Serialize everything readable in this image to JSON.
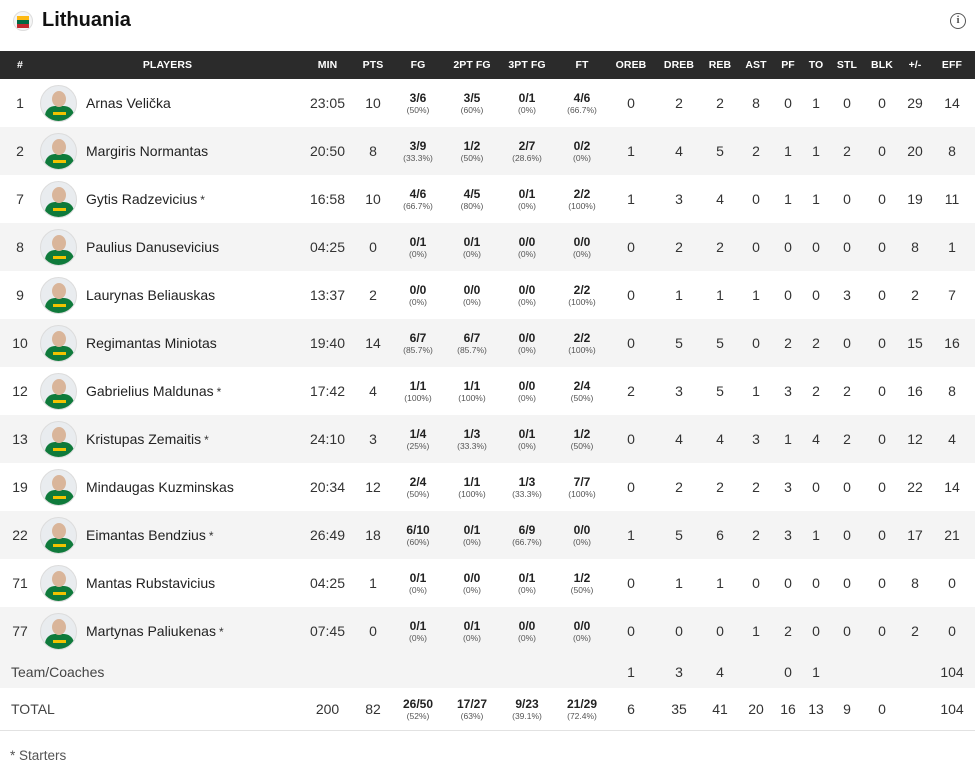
{
  "team": {
    "name": "Lithuania"
  },
  "headers": {
    "num": "#",
    "players": "PLAYERS",
    "min": "MIN",
    "pts": "PTS",
    "fg": "FG",
    "fg2": "2PT FG",
    "fg3": "3PT FG",
    "ft": "FT",
    "oreb": "OREB",
    "dreb": "DREB",
    "reb": "REB",
    "ast": "AST",
    "pf": "PF",
    "to": "TO",
    "stl": "STL",
    "blk": "BLK",
    "pm": "+/-",
    "eff": "EFF"
  },
  "players": [
    {
      "num": "1",
      "name": "Arnas Velička",
      "starter": "",
      "min": "23:05",
      "pts": "10",
      "fg": "3/6",
      "fg_pct": "(50%)",
      "fg2": "3/5",
      "fg2_pct": "(60%)",
      "fg3": "0/1",
      "fg3_pct": "(0%)",
      "ft": "4/6",
      "ft_pct": "(66.7%)",
      "oreb": "0",
      "dreb": "2",
      "reb": "2",
      "ast": "8",
      "pf": "0",
      "to": "1",
      "stl": "0",
      "blk": "0",
      "pm": "29",
      "eff": "14"
    },
    {
      "num": "2",
      "name": "Margiris Normantas",
      "starter": "",
      "min": "20:50",
      "pts": "8",
      "fg": "3/9",
      "fg_pct": "(33.3%)",
      "fg2": "1/2",
      "fg2_pct": "(50%)",
      "fg3": "2/7",
      "fg3_pct": "(28.6%)",
      "ft": "0/2",
      "ft_pct": "(0%)",
      "oreb": "1",
      "dreb": "4",
      "reb": "5",
      "ast": "2",
      "pf": "1",
      "to": "1",
      "stl": "2",
      "blk": "0",
      "pm": "20",
      "eff": "8"
    },
    {
      "num": "7",
      "name": "Gytis Radzevicius",
      "starter": "*",
      "min": "16:58",
      "pts": "10",
      "fg": "4/6",
      "fg_pct": "(66.7%)",
      "fg2": "4/5",
      "fg2_pct": "(80%)",
      "fg3": "0/1",
      "fg3_pct": "(0%)",
      "ft": "2/2",
      "ft_pct": "(100%)",
      "oreb": "1",
      "dreb": "3",
      "reb": "4",
      "ast": "0",
      "pf": "1",
      "to": "1",
      "stl": "0",
      "blk": "0",
      "pm": "19",
      "eff": "11"
    },
    {
      "num": "8",
      "name": "Paulius Danusevicius",
      "starter": "",
      "min": "04:25",
      "pts": "0",
      "fg": "0/1",
      "fg_pct": "(0%)",
      "fg2": "0/1",
      "fg2_pct": "(0%)",
      "fg3": "0/0",
      "fg3_pct": "(0%)",
      "ft": "0/0",
      "ft_pct": "(0%)",
      "oreb": "0",
      "dreb": "2",
      "reb": "2",
      "ast": "0",
      "pf": "0",
      "to": "0",
      "stl": "0",
      "blk": "0",
      "pm": "8",
      "eff": "1"
    },
    {
      "num": "9",
      "name": "Laurynas Beliauskas",
      "starter": "",
      "min": "13:37",
      "pts": "2",
      "fg": "0/0",
      "fg_pct": "(0%)",
      "fg2": "0/0",
      "fg2_pct": "(0%)",
      "fg3": "0/0",
      "fg3_pct": "(0%)",
      "ft": "2/2",
      "ft_pct": "(100%)",
      "oreb": "0",
      "dreb": "1",
      "reb": "1",
      "ast": "1",
      "pf": "0",
      "to": "0",
      "stl": "3",
      "blk": "0",
      "pm": "2",
      "eff": "7"
    },
    {
      "num": "10",
      "name": "Regimantas Miniotas",
      "starter": "",
      "min": "19:40",
      "pts": "14",
      "fg": "6/7",
      "fg_pct": "(85.7%)",
      "fg2": "6/7",
      "fg2_pct": "(85.7%)",
      "fg3": "0/0",
      "fg3_pct": "(0%)",
      "ft": "2/2",
      "ft_pct": "(100%)",
      "oreb": "0",
      "dreb": "5",
      "reb": "5",
      "ast": "0",
      "pf": "2",
      "to": "2",
      "stl": "0",
      "blk": "0",
      "pm": "15",
      "eff": "16"
    },
    {
      "num": "12",
      "name": "Gabrielius Maldunas",
      "starter": "*",
      "min": "17:42",
      "pts": "4",
      "fg": "1/1",
      "fg_pct": "(100%)",
      "fg2": "1/1",
      "fg2_pct": "(100%)",
      "fg3": "0/0",
      "fg3_pct": "(0%)",
      "ft": "2/4",
      "ft_pct": "(50%)",
      "oreb": "2",
      "dreb": "3",
      "reb": "5",
      "ast": "1",
      "pf": "3",
      "to": "2",
      "stl": "2",
      "blk": "0",
      "pm": "16",
      "eff": "8"
    },
    {
      "num": "13",
      "name": "Kristupas Zemaitis",
      "starter": "*",
      "min": "24:10",
      "pts": "3",
      "fg": "1/4",
      "fg_pct": "(25%)",
      "fg2": "1/3",
      "fg2_pct": "(33.3%)",
      "fg3": "0/1",
      "fg3_pct": "(0%)",
      "ft": "1/2",
      "ft_pct": "(50%)",
      "oreb": "0",
      "dreb": "4",
      "reb": "4",
      "ast": "3",
      "pf": "1",
      "to": "4",
      "stl": "2",
      "blk": "0",
      "pm": "12",
      "eff": "4"
    },
    {
      "num": "19",
      "name": "Mindaugas Kuzminskas",
      "starter": "",
      "min": "20:34",
      "pts": "12",
      "fg": "2/4",
      "fg_pct": "(50%)",
      "fg2": "1/1",
      "fg2_pct": "(100%)",
      "fg3": "1/3",
      "fg3_pct": "(33.3%)",
      "ft": "7/7",
      "ft_pct": "(100%)",
      "oreb": "0",
      "dreb": "2",
      "reb": "2",
      "ast": "2",
      "pf": "3",
      "to": "0",
      "stl": "0",
      "blk": "0",
      "pm": "22",
      "eff": "14"
    },
    {
      "num": "22",
      "name": "Eimantas Bendzius",
      "starter": "*",
      "min": "26:49",
      "pts": "18",
      "fg": "6/10",
      "fg_pct": "(60%)",
      "fg2": "0/1",
      "fg2_pct": "(0%)",
      "fg3": "6/9",
      "fg3_pct": "(66.7%)",
      "ft": "0/0",
      "ft_pct": "(0%)",
      "oreb": "1",
      "dreb": "5",
      "reb": "6",
      "ast": "2",
      "pf": "3",
      "to": "1",
      "stl": "0",
      "blk": "0",
      "pm": "17",
      "eff": "21"
    },
    {
      "num": "71",
      "name": "Mantas Rubstavicius",
      "starter": "",
      "min": "04:25",
      "pts": "1",
      "fg": "0/1",
      "fg_pct": "(0%)",
      "fg2": "0/0",
      "fg2_pct": "(0%)",
      "fg3": "0/1",
      "fg3_pct": "(0%)",
      "ft": "1/2",
      "ft_pct": "(50%)",
      "oreb": "0",
      "dreb": "1",
      "reb": "1",
      "ast": "0",
      "pf": "0",
      "to": "0",
      "stl": "0",
      "blk": "0",
      "pm": "8",
      "eff": "0"
    },
    {
      "num": "77",
      "name": "Martynas Paliukenas",
      "starter": "*",
      "min": "07:45",
      "pts": "0",
      "fg": "0/1",
      "fg_pct": "(0%)",
      "fg2": "0/1",
      "fg2_pct": "(0%)",
      "fg3": "0/0",
      "fg3_pct": "(0%)",
      "ft": "0/0",
      "ft_pct": "(0%)",
      "oreb": "0",
      "dreb": "0",
      "reb": "0",
      "ast": "1",
      "pf": "2",
      "to": "0",
      "stl": "0",
      "blk": "0",
      "pm": "2",
      "eff": "0"
    }
  ],
  "team_coaches": {
    "label": "Team/Coaches",
    "min": "",
    "pts": "",
    "fg": "",
    "fg_pct": "",
    "fg2": "",
    "fg2_pct": "",
    "fg3": "",
    "fg3_pct": "",
    "ft": "",
    "ft_pct": "",
    "oreb": "1",
    "dreb": "3",
    "reb": "4",
    "ast": "",
    "pf": "0",
    "to": "1",
    "stl": "",
    "blk": "",
    "pm": "",
    "eff": "104"
  },
  "total": {
    "label": "TOTAL",
    "min": "200",
    "pts": "82",
    "fg": "26/50",
    "fg_pct": "(52%)",
    "fg2": "17/27",
    "fg2_pct": "(63%)",
    "fg3": "9/23",
    "fg3_pct": "(39.1%)",
    "ft": "21/29",
    "ft_pct": "(72.4%)",
    "oreb": "6",
    "dreb": "35",
    "reb": "41",
    "ast": "20",
    "pf": "16",
    "to": "13",
    "stl": "9",
    "blk": "0",
    "pm": "",
    "eff": "104"
  },
  "footnote": "* Starters",
  "icons": {
    "flag": "lithuania-flag-icon",
    "info": "info-icon"
  },
  "colors": {
    "header_bg": "#2b2b2b",
    "alt_row": "#f4f4f4"
  }
}
